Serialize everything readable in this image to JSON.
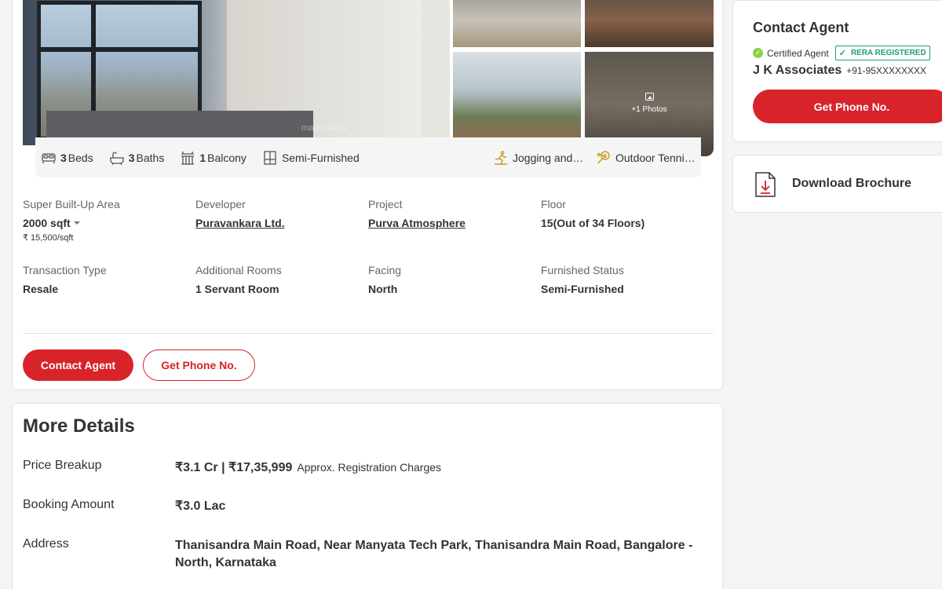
{
  "gallery": {
    "watermark": "magicbricks",
    "more_photos": "+1 Photos"
  },
  "amenities": {
    "beds_count": "3",
    "beds_label": "Beds",
    "baths_count": "3",
    "baths_label": "Baths",
    "balcony_count": "1",
    "balcony_label": "Balcony",
    "furnishing": "Semi-Furnished",
    "jogging": "Jogging and Strolling Track",
    "tennis": "Outdoor Tennis Courts"
  },
  "specs": {
    "super_area_label": "Super Built-Up Area",
    "super_area_value": "2000 sqft",
    "price_per_sqft": "₹ 15,500/sqft",
    "developer_label": "Developer",
    "developer_value": "Puravankara Ltd.",
    "project_label": "Project",
    "project_value": "Purva Atmosphere",
    "floor_label": "Floor",
    "floor_value": "15(Out of 34 Floors)",
    "transaction_label": "Transaction Type",
    "transaction_value": "Resale",
    "rooms_label": "Additional Rooms",
    "rooms_value": "1 Servant Room",
    "facing_label": "Facing",
    "facing_value": "North",
    "furnished_label": "Furnished Status",
    "furnished_value": "Semi-Furnished"
  },
  "actions": {
    "contact_agent": "Contact Agent",
    "get_phone": "Get Phone No."
  },
  "more_details": {
    "title": "More Details",
    "price_label": "Price Breakup",
    "price_value": "₹3.1 Cr | ₹17,35,999",
    "price_note": "Approx. Registration Charges",
    "booking_label": "Booking Amount",
    "booking_value": "₹3.0 Lac",
    "address_label": "Address",
    "address_value": "Thanisandra Main Road, Near Manyata Tech Park, Thanisandra Main Road, Bangalore - North, Karnataka"
  },
  "sidebar": {
    "title": "Contact Agent",
    "certified": "Certified Agent",
    "rera": "RERA REGISTERED",
    "agent_name": "J K Associates",
    "agent_phone": "+91-95XXXXXXXX",
    "get_phone": "Get Phone No.",
    "brochure": "Download Brochure"
  },
  "colors": {
    "brand_red": "#d8232a",
    "rera_green": "#1a9e75",
    "check_green": "#8bd24a",
    "amenity_gold": "#c8961e"
  }
}
